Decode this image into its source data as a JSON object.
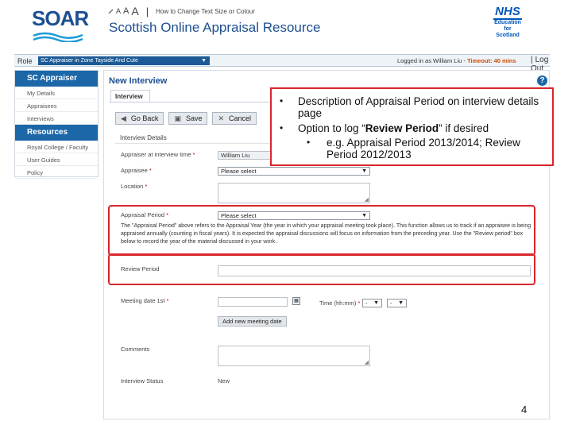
{
  "header": {
    "logo": "SOAR",
    "text_size": {
      "a_small": "A",
      "a_medium": "A",
      "a_large": "A",
      "separator": "|",
      "link": "How to Change Text Size or Colour"
    },
    "site_title": "Scottish Online Appraisal Resource",
    "nhs_logo": {
      "nhs": "NHS",
      "line1": "Education",
      "line2": "for",
      "line3": "Scotland"
    }
  },
  "rolebar": {
    "role_label": "Role",
    "role_value": "SC Appraiser in Zone Tayside And Cute",
    "logged_in_text": "Logged in as William Liu - ",
    "timeout_text": "Timeout: 40 mins",
    "logout_label": "Log Out",
    "separator": "|"
  },
  "sidebar": {
    "section1": "SC Appraiser",
    "items1": [
      "My Details",
      "Appraisees",
      "Interviews"
    ],
    "section2": "Resources",
    "items2": [
      "Royal College / Faculty",
      "User Guides",
      "Policy"
    ]
  },
  "main": {
    "title": "New Interview",
    "tab": "Interview",
    "toolbar": {
      "go_back": "Go Back",
      "save": "Save",
      "cancel": "Cancel"
    },
    "details_label": "Interview Details",
    "fields": {
      "appraiser_label": "Appraiser at interview time",
      "appraiser_value": "William Liu",
      "appraisee_label": "Appraisee",
      "appraisee_value": "Please select",
      "location_label": "Location",
      "appraisal_period_label": "Appraisal Period",
      "appraisal_period_value": "Please select",
      "help_text": "The \"Appraisal Period\" above refers to the Appraisal Year (the year in which your appraisal meeting took place). This function allows us to track if an appraisee is being appraised annually (counting in fiscal years). It is expected the appraisal discussions will focus on information from the preceding year. Use the \"Review period\" box below to record the year of the material discussed in your work.",
      "review_period_label": "Review Period",
      "meeting_date_label": "Meeting date 1st",
      "time_label": "Time (hh:mm)",
      "time_hour": "-",
      "time_minute": "-",
      "add_meeting_button": "Add new meeting date",
      "comments_label": "Comments",
      "status_label": "Interview Status",
      "status_value": "New",
      "required_marker": "*"
    }
  },
  "callout": {
    "bullet1": "Description of Appraisal Period on interview details page",
    "bullet2_prefix": "Option to log “",
    "bullet2_bold": "Review Period",
    "bullet2_suffix": "” if desired",
    "sub_bullet": "e.g. Appraisal Period 2013/2014; Review Period 2012/2013",
    "bullet_char": "•"
  },
  "page_number": "4",
  "colors": {
    "brand_blue": "#1d4f91",
    "sidebar_blue": "#1b67a8",
    "highlight_red": "#d9262c",
    "timeout_orange": "#d04a00"
  }
}
